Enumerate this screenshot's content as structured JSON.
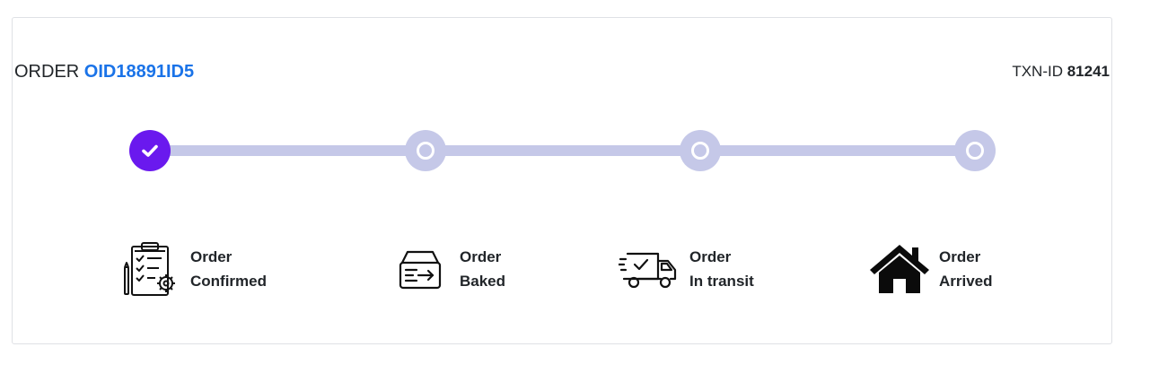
{
  "header": {
    "order_prefix": "ORDER",
    "order_id": "OID18891ID5",
    "txn_prefix": "TXN-ID",
    "txn_id": "81241"
  },
  "progress": {
    "completed_steps": 1,
    "total_steps": 4,
    "colors": {
      "done": "#6a19ee",
      "pending": "#c5c8e8"
    }
  },
  "stages": [
    {
      "icon": "clipboard-checklist-icon",
      "line1": "Order",
      "line2": "Confirmed"
    },
    {
      "icon": "box-arrow-icon",
      "line1": "Order",
      "line2": "Baked"
    },
    {
      "icon": "delivery-truck-icon",
      "line1": "Order",
      "line2": "In transit"
    },
    {
      "icon": "home-icon",
      "line1": "Order",
      "line2": "Arrived"
    }
  ],
  "accent_color": "#1a73e8"
}
